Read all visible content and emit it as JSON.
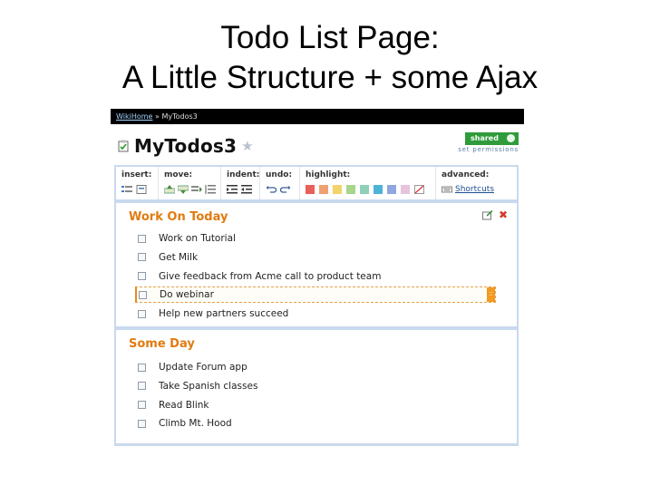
{
  "slide": {
    "title_line1": "Todo List Page:",
    "title_line2": "A Little Structure + some Ajax"
  },
  "breadcrumb": {
    "home": "WikiHome",
    "separator": "»",
    "current": "MyTodos3"
  },
  "page": {
    "title": "MyTodos3",
    "shared_label": "shared",
    "set_permissions": "set permissions"
  },
  "toolbar": {
    "insert": "insert:",
    "move": "move:",
    "indent": "indent:",
    "undo": "undo:",
    "highlight": "highlight:",
    "advanced": "advanced:",
    "shortcuts": "Shortcuts",
    "highlight_colors": [
      "#e8605a",
      "#f0a070",
      "#f3d36b",
      "#a8d58c",
      "#8fd0b8",
      "#4fb3d9",
      "#8fa7e0",
      "#e8c4dc"
    ]
  },
  "sections": [
    {
      "title": "Work On Today",
      "items": [
        "Work on Tutorial",
        "Get Milk",
        "Give feedback from Acme call to product team",
        "Do webinar",
        "Help new partners succeed"
      ],
      "active_index": 3
    },
    {
      "title": "Some Day",
      "items": [
        "Update Forum app",
        "Take Spanish classes",
        "Read Blink",
        "Climb Mt. Hood"
      ]
    }
  ],
  "colors": {
    "accent_orange": "#e07b10",
    "frame_blue": "#c9d9ee",
    "shared_green": "#2f9b3b"
  }
}
